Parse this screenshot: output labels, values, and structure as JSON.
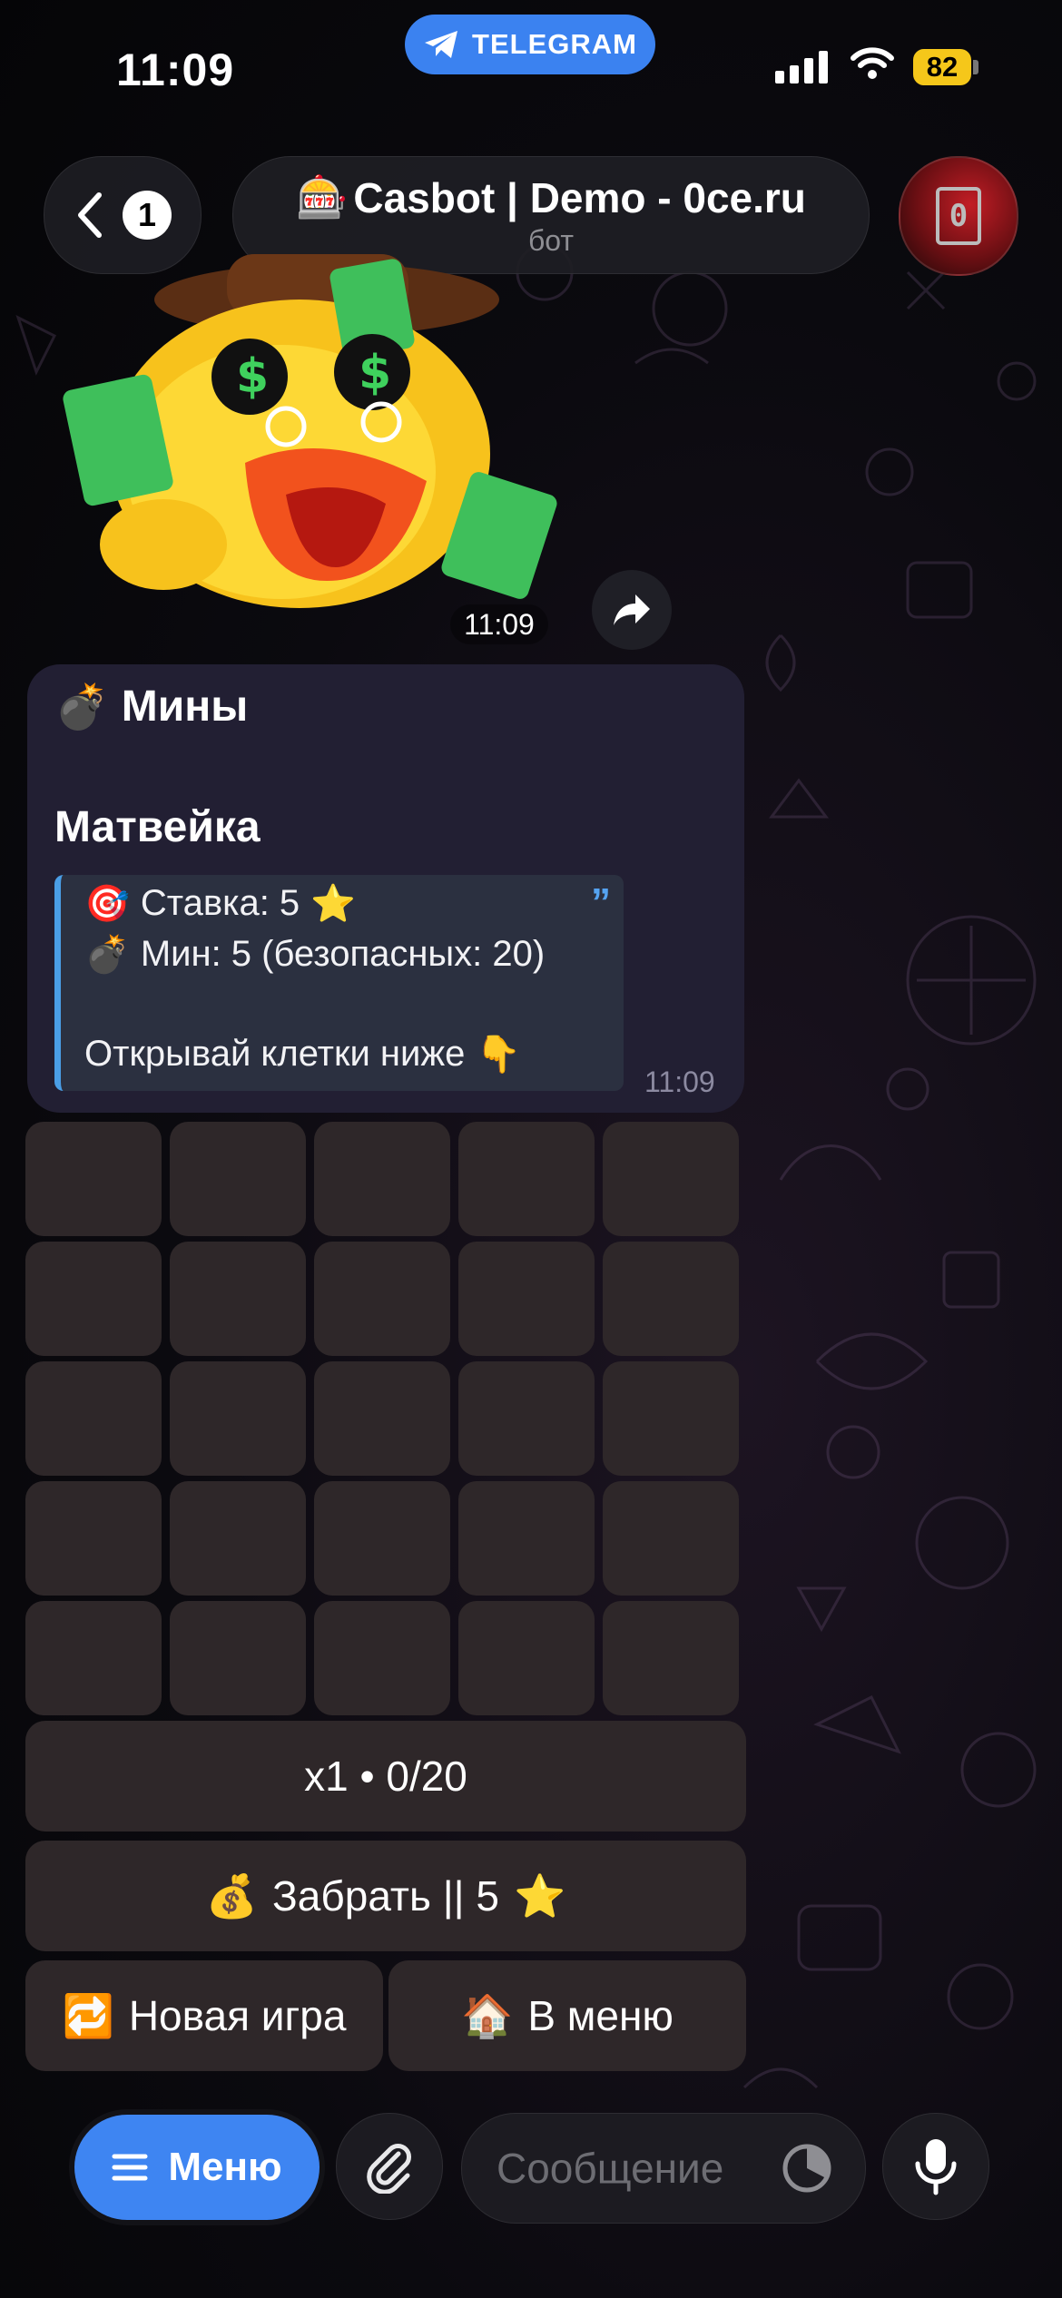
{
  "status_bar": {
    "time": "11:09",
    "app_pill": "TELEGRAM",
    "battery": "82"
  },
  "header": {
    "back_count": "1",
    "title_icon": "🎰",
    "title": "Casbot | Demo - 0ce.ru",
    "subtitle": "бот",
    "avatar_text": "0"
  },
  "sticker": {
    "time": "11:09"
  },
  "message": {
    "game_icon": "💣",
    "game_title": "Мины",
    "player_name": "Матвейка",
    "quote": {
      "bet_icon": "🎯",
      "bet": "Ставка: 5",
      "bet_star": "⭐",
      "mines_icon": "💣",
      "mines": "Мин: 5 (безопасных: 20)",
      "instruction": "Открывай клетки ниже",
      "instruction_icon": "👇"
    },
    "time": "11:09"
  },
  "keyboard": {
    "grid_rows": 5,
    "grid_cols": 5,
    "multiplier": "x1 • 0/20",
    "cashout_icon": "💰",
    "cashout": "Забрать || 5",
    "cashout_star": "⭐",
    "new_game_icon": "🔁",
    "new_game": "Новая игра",
    "menu_icon": "🏠",
    "menu": "В меню"
  },
  "input_bar": {
    "menu_button": "Меню",
    "placeholder": "Сообщение"
  },
  "colors": {
    "accent": "#3e85f2",
    "message_bg": "#221f33",
    "quote_bar": "#4a9ee6",
    "keyboard_button": "#2e2729"
  }
}
